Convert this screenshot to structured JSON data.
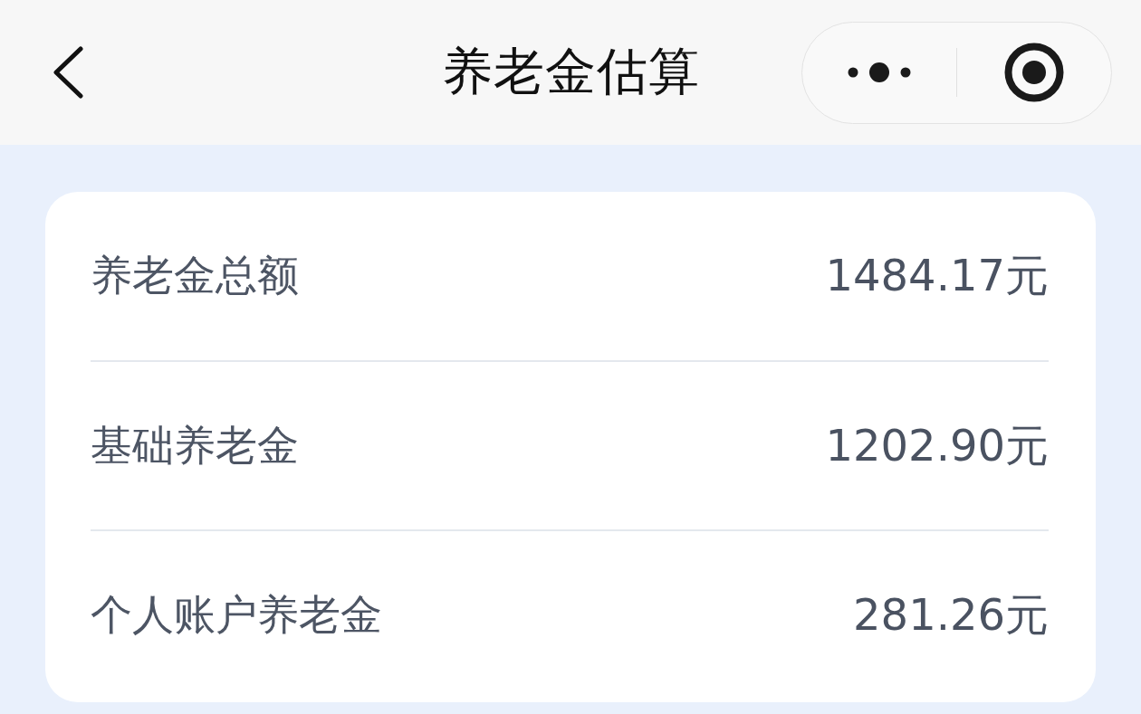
{
  "header": {
    "title": "养老金估算"
  },
  "items": [
    {
      "label": "养老金总额",
      "value": "1484.17元"
    },
    {
      "label": "基础养老金",
      "value": "1202.90元"
    },
    {
      "label": "个人账户养老金",
      "value": "281.26元"
    }
  ]
}
